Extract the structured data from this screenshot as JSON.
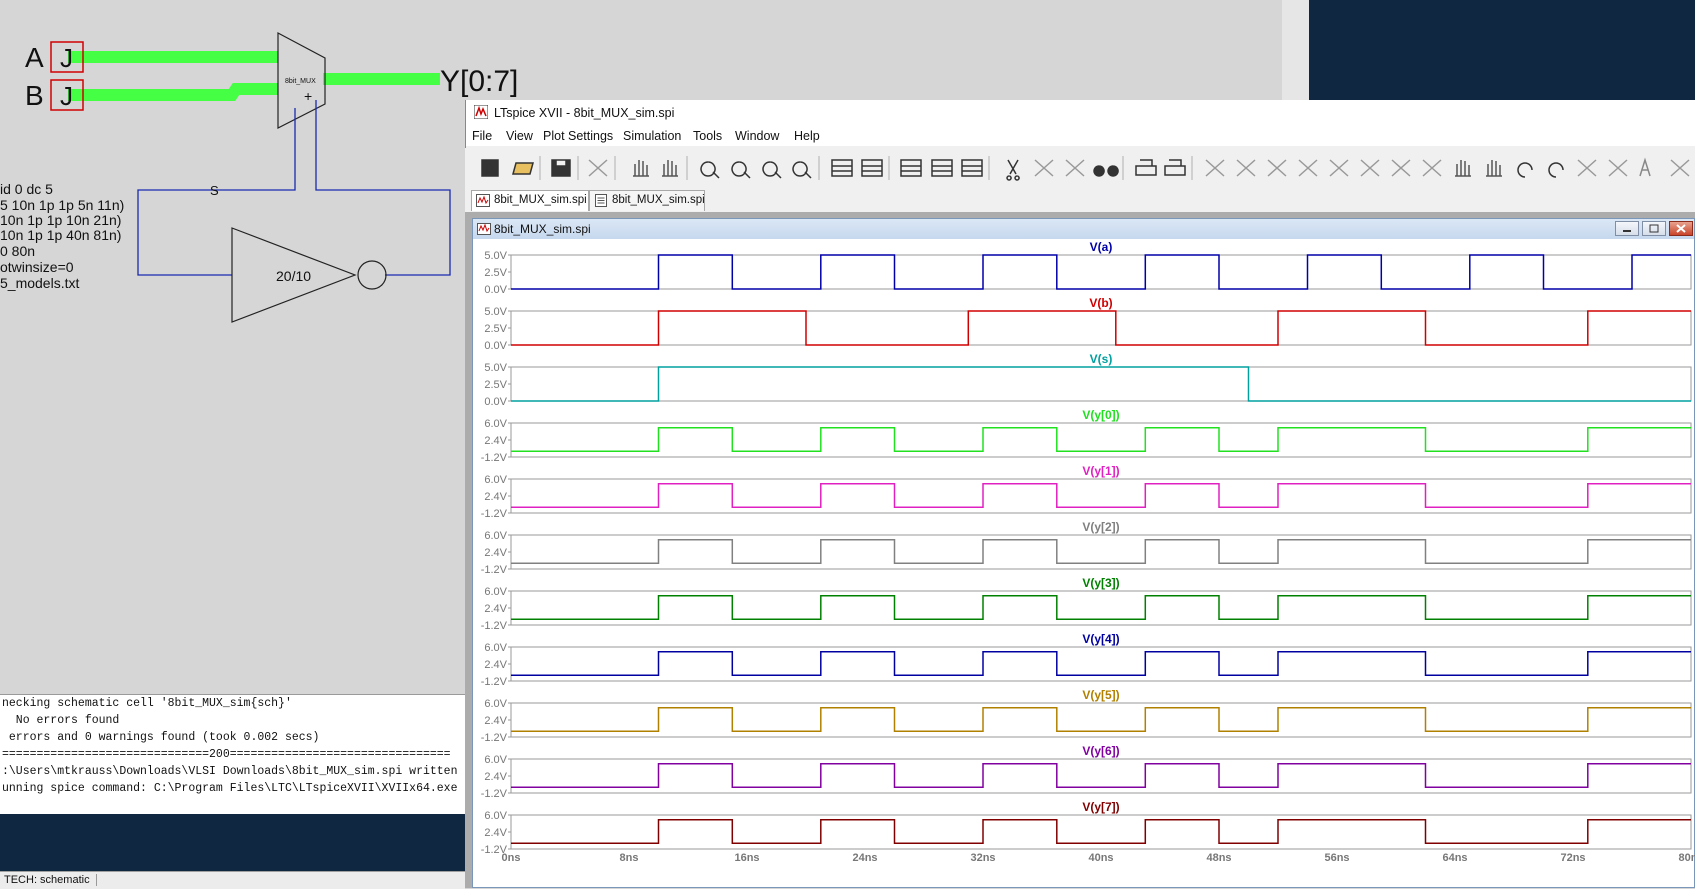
{
  "schematic": {
    "port_a": "A",
    "port_b": "B",
    "output_bus": "Y[0:7]",
    "mux_label": "8bit_MUX",
    "select_net": "S",
    "inverter_size": "20/10",
    "directives": [
      "id 0 dc 5",
      "5 10n 1p 1p 5n 11n)",
      " 10n 1p 1p 10n 21n)",
      " 10n 1p 1p 40n 81n)",
      " 0 80n",
      "otwinsize=0",
      "5_models.txt"
    ]
  },
  "console": {
    "lines": [
      "necking schematic cell '8bit_MUX_sim{sch}'",
      "  No errors found",
      " errors and 0 warnings found (took 0.002 secs)",
      "==============================200================================",
      ":\\Users\\mtkrauss\\Downloads\\VLSI Downloads\\8bit_MUX_sim.spi written",
      "unning spice command: C:\\Program Files\\LTC\\LTspiceXVII\\XVIIx64.exe"
    ]
  },
  "status_bar": {
    "tech": "TECH: schematic"
  },
  "ltspice": {
    "title": "LTspice XVII - 8bit_MUX_sim.spi",
    "menu": [
      "File",
      "View",
      "Plot Settings",
      "Simulation",
      "Tools",
      "Window",
      "Help"
    ],
    "tabs": [
      "8bit_MUX_sim.spi",
      "8bit_MUX_sim.spi"
    ],
    "plot_window_title": "8bit_MUX_sim.spi",
    "toolbar_icons": [
      "run-icon",
      "open-icon",
      "save-icon",
      "control-panel-icon",
      "halt-icon",
      "pan-icon",
      "zoom-in-icon",
      "zoom-full-icon",
      "zoom-out-icon",
      "zoom-cancel-icon",
      "autorange-icon",
      "plot-pane-icon",
      "tile-horizontal-icon",
      "cascade-icon",
      "tile-vertical-icon",
      "cut-icon",
      "copy-icon",
      "paste-icon",
      "find-icon",
      "print-icon",
      "print-setup-icon",
      "wire-icon",
      "ground-icon",
      "label-icon",
      "resistor-icon",
      "capacitor-icon",
      "inductor-icon",
      "diode-icon",
      "component-icon",
      "move-icon",
      "drag-icon",
      "undo-icon",
      "redo-icon",
      "rotate-icon",
      "mirror-icon",
      "text-icon",
      "spice-directive-icon"
    ]
  },
  "chart_data": {
    "type": "line",
    "x_unit": "ns",
    "xlim": [
      0,
      80
    ],
    "x_ticks": [
      "0ns",
      "8ns",
      "16ns",
      "24ns",
      "32ns",
      "40ns",
      "48ns",
      "56ns",
      "64ns",
      "72ns",
      "80ns"
    ],
    "pulses": {
      "a": [
        [
          10,
          15
        ],
        [
          21,
          26
        ],
        [
          32,
          37
        ],
        [
          43,
          48
        ],
        [
          54,
          59
        ],
        [
          65,
          70
        ],
        [
          76,
          80
        ]
      ],
      "b": [
        [
          10,
          20
        ],
        [
          31,
          41
        ],
        [
          52,
          62
        ],
        [
          73,
          80
        ]
      ],
      "s": [
        [
          10,
          50
        ]
      ]
    },
    "panes": [
      {
        "name": "V(a)",
        "color": "#0000a8",
        "y_ticks": [
          "5.0V",
          "2.5V",
          "0.0V"
        ],
        "ylim": [
          0,
          5
        ],
        "source": "a"
      },
      {
        "name": "V(b)",
        "color": "#d00000",
        "y_ticks": [
          "5.0V",
          "2.5V",
          "0.0V"
        ],
        "ylim": [
          0,
          5
        ],
        "source": "b"
      },
      {
        "name": "V(s)",
        "color": "#00a0a0",
        "y_ticks": [
          "5.0V",
          "2.5V",
          "0.0V"
        ],
        "ylim": [
          0,
          5
        ],
        "source": "s"
      },
      {
        "name": "V(y[0])",
        "color": "#20e020",
        "y_ticks": [
          "6.0V",
          "2.4V",
          "-1.2V"
        ],
        "ylim": [
          -1.2,
          6
        ],
        "source": "y"
      },
      {
        "name": "V(y[1])",
        "color": "#e020c0",
        "y_ticks": [
          "6.0V",
          "2.4V",
          "-1.2V"
        ],
        "ylim": [
          -1.2,
          6
        ],
        "source": "y"
      },
      {
        "name": "V(y[2])",
        "color": "#808080",
        "y_ticks": [
          "6.0V",
          "2.4V",
          "-1.2V"
        ],
        "ylim": [
          -1.2,
          6
        ],
        "source": "y"
      },
      {
        "name": "V(y[3])",
        "color": "#008000",
        "y_ticks": [
          "6.0V",
          "2.4V",
          "-1.2V"
        ],
        "ylim": [
          -1.2,
          6
        ],
        "source": "y"
      },
      {
        "name": "V(y[4])",
        "color": "#0000a0",
        "y_ticks": [
          "6.0V",
          "2.4V",
          "-1.2V"
        ],
        "ylim": [
          -1.2,
          6
        ],
        "source": "y"
      },
      {
        "name": "V(y[5])",
        "color": "#b08000",
        "y_ticks": [
          "6.0V",
          "2.4V",
          "-1.2V"
        ],
        "ylim": [
          -1.2,
          6
        ],
        "source": "y"
      },
      {
        "name": "V(y[6])",
        "color": "#8000a0",
        "y_ticks": [
          "6.0V",
          "2.4V",
          "-1.2V"
        ],
        "ylim": [
          -1.2,
          6
        ],
        "source": "y"
      },
      {
        "name": "V(y[7])",
        "color": "#800000",
        "y_ticks": [
          "6.0V",
          "2.4V",
          "-1.2V"
        ],
        "ylim": [
          -1.2,
          6
        ],
        "source": "y"
      }
    ],
    "y_output_levels": {
      "high": 5,
      "low": 0
    }
  }
}
